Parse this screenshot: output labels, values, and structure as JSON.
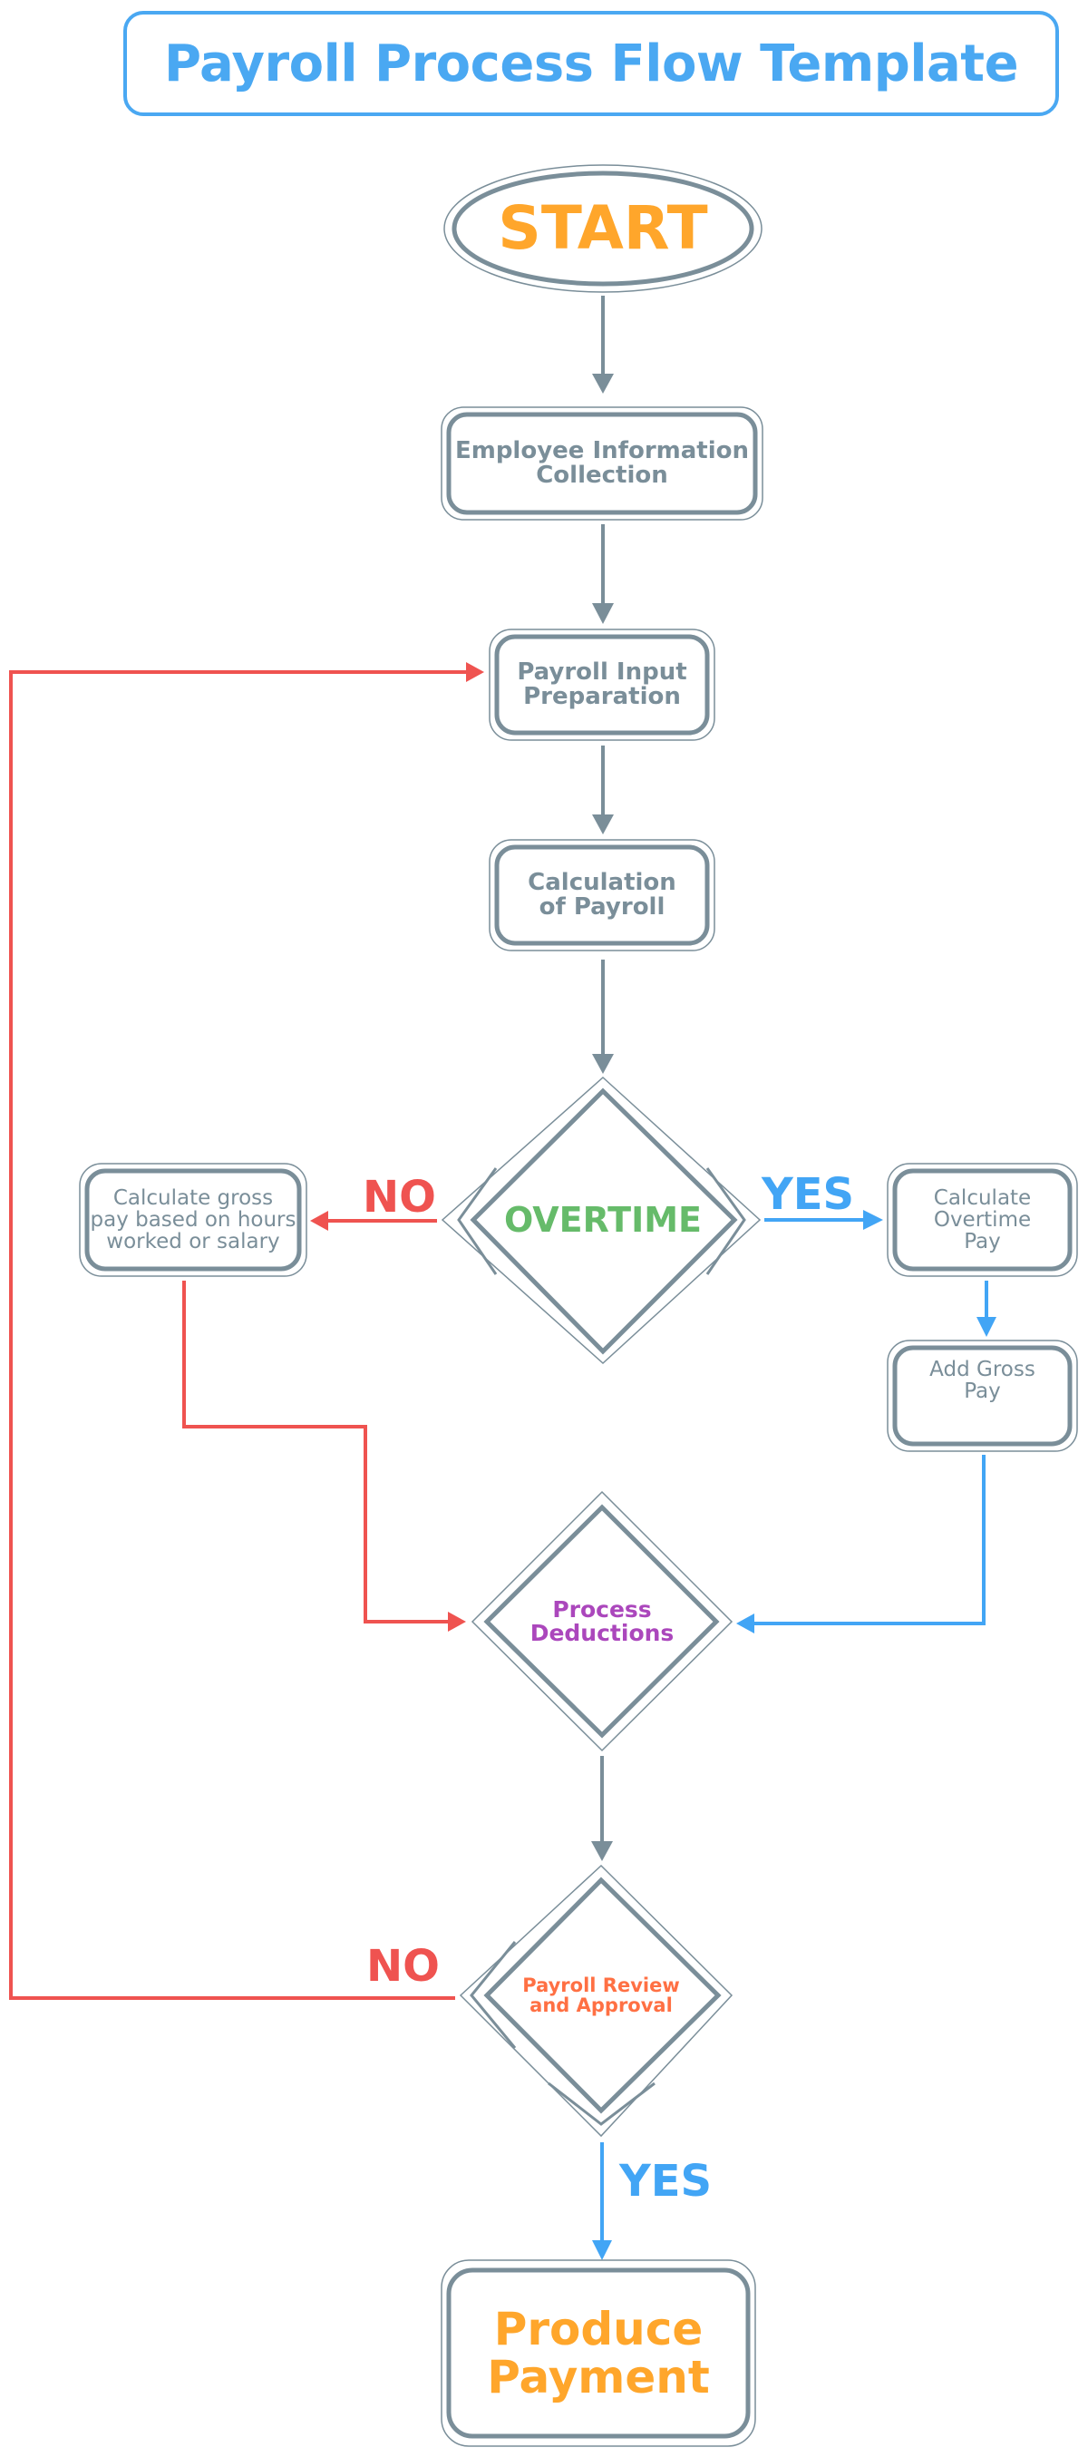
{
  "title": "Payroll Process Flow Template",
  "colors": {
    "title": "#4aa8f2",
    "node_stroke": "#7a8e99",
    "node_text": "#7a8e99",
    "start": "#ffa62b",
    "no_branch": "#ef5350",
    "yes_branch": "#42a5f5",
    "overtime": "#66bb6a",
    "deductions": "#ab47bc",
    "review": "#ff7043",
    "produce": "#ffa62b"
  },
  "nodes": {
    "start": "START",
    "employee_info": "Employee Information\nCollection",
    "payroll_input": "Payroll Input\nPreparation",
    "calculation": "Calculation\nof Payroll",
    "overtime": "OVERTIME",
    "gross_pay": "Calculate gross\npay based on hours\nworked or salary",
    "overtime_pay": "Calculate\nOvertime\nPay",
    "add_gross": "Add Gross\nPay",
    "deductions": "Process\nDeductions",
    "review": "Payroll Review\nand Approval",
    "produce": "Produce\nPayment"
  },
  "branch_labels": {
    "overtime_no": "NO",
    "overtime_yes": "YES",
    "review_no": "NO",
    "review_yes": "YES"
  }
}
